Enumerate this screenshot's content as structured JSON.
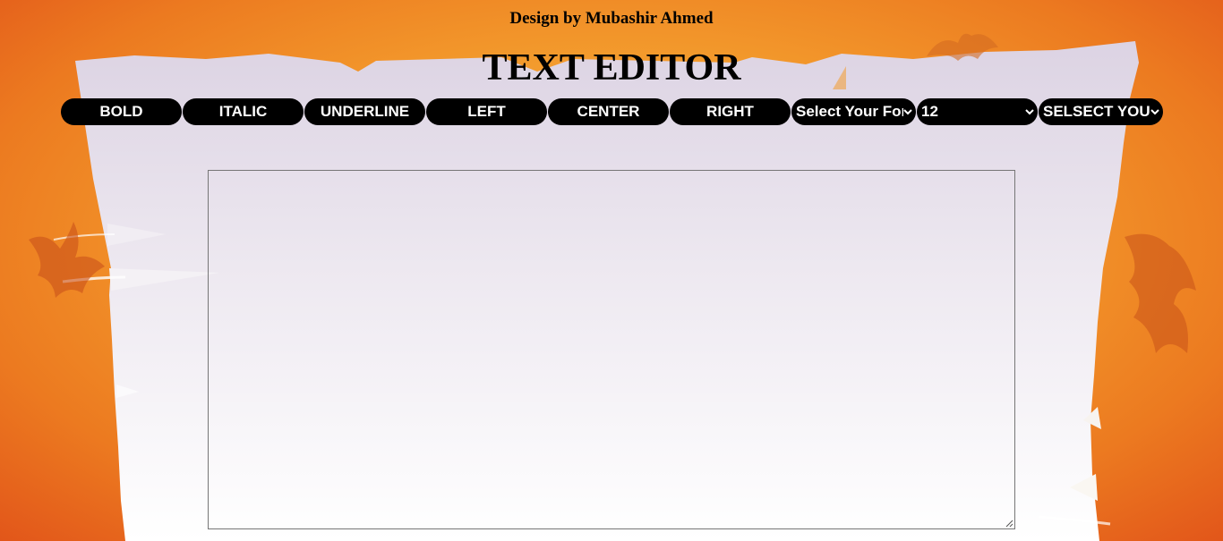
{
  "header": {
    "credit": "Design by Mubashir Ahmed",
    "title": "TEXT EDITOR"
  },
  "toolbar": {
    "bold_label": "BOLD",
    "italic_label": "ITALIC",
    "underline_label": "UNDERLINE",
    "left_label": "LEFT",
    "center_label": "CENTER",
    "right_label": "RIGHT",
    "font_select_value": "Select Your Font",
    "size_select_value": "12",
    "color_select_value": "SELSECT YOUR COLOR"
  },
  "editor": {
    "value": ""
  },
  "colors": {
    "button_bg": "#000000",
    "button_text": "#ffffff",
    "background_orange": "#f39a2c"
  },
  "icons": {
    "select_arrow": "chevron-down-icon",
    "textarea_resize": "resize-handle-icon"
  }
}
